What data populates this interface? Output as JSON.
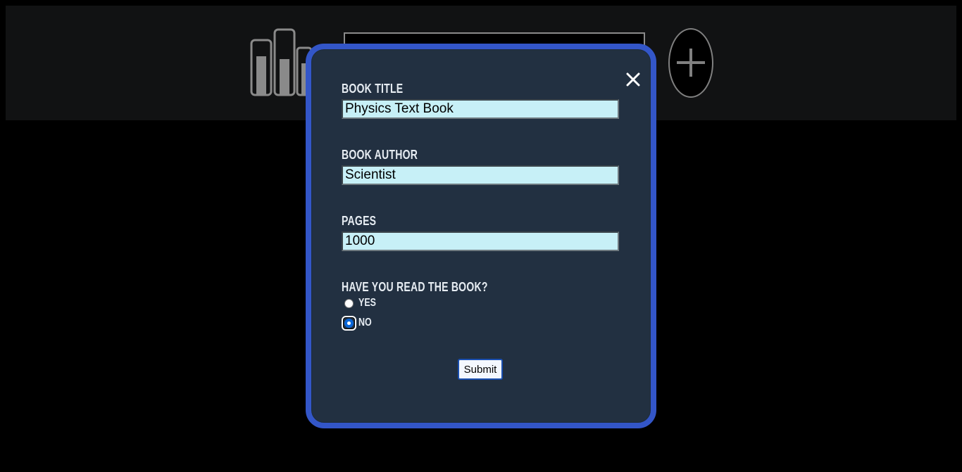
{
  "header": {
    "logo_icon": "bookshelf-icon",
    "add_icon": "plus-icon"
  },
  "modal": {
    "close_icon": "close-icon",
    "fields": {
      "title": {
        "label": "Book Title",
        "value": "Physics Text Book"
      },
      "author": {
        "label": "Book Author",
        "value": "Scientist"
      },
      "pages": {
        "label": "Pages",
        "value": "1000"
      }
    },
    "read_question": "Have you read the book?",
    "read_options": {
      "yes": {
        "label": "Yes",
        "checked": false
      },
      "no": {
        "label": "No",
        "checked": true
      }
    },
    "submit_label": "Submit"
  },
  "colors": {
    "modal_background": "#223041",
    "modal_border": "#3356c8",
    "input_background": "#c7f0f7",
    "header_background": "#111213"
  }
}
